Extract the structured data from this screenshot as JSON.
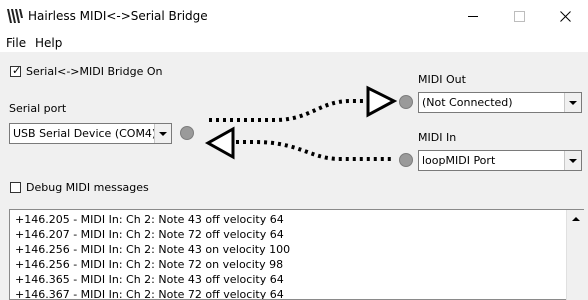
{
  "window": {
    "title": "Hairless MIDI<->Serial Bridge"
  },
  "menu": {
    "file": "File",
    "help": "Help"
  },
  "bridge_toggle": {
    "label": "Serial<->MIDI Bridge On",
    "checked": true
  },
  "serial": {
    "label": "Serial port",
    "selected": "USB Serial Device (COM4)"
  },
  "midi_out": {
    "label": "MIDI Out",
    "selected": "(Not Connected)"
  },
  "midi_in": {
    "label": "MIDI In",
    "selected": "loopMIDI Port"
  },
  "debug_toggle": {
    "label": "Debug MIDI messages",
    "checked": false
  },
  "log": {
    "lines": [
      "+146.205 - MIDI In: Ch 2: Note 43 off velocity 64",
      "+146.207 - MIDI In: Ch 2: Note 72 off velocity 64",
      "+146.256 - MIDI In: Ch 2: Note 43 on  velocity 100",
      "+146.256 - MIDI In: Ch 2: Note 72 on  velocity 98",
      "+146.365 - MIDI In: Ch 2: Note 43 off velocity 64",
      "+146.367 - MIDI In: Ch 2: Note 72 off velocity 64"
    ]
  },
  "icons": {
    "app": "hairless-app-icon",
    "minimize": "minimize-icon",
    "maximize": "maximize-icon",
    "close": "close-icon",
    "dropdown": "chevron-down-icon",
    "scroll_up": "scroll-up-arrow-icon",
    "status": "status-dot-icon"
  },
  "colors": {
    "titlebar": "#ffffff",
    "window": "#f0f0f0",
    "status_dot": "#9a9a9a"
  }
}
